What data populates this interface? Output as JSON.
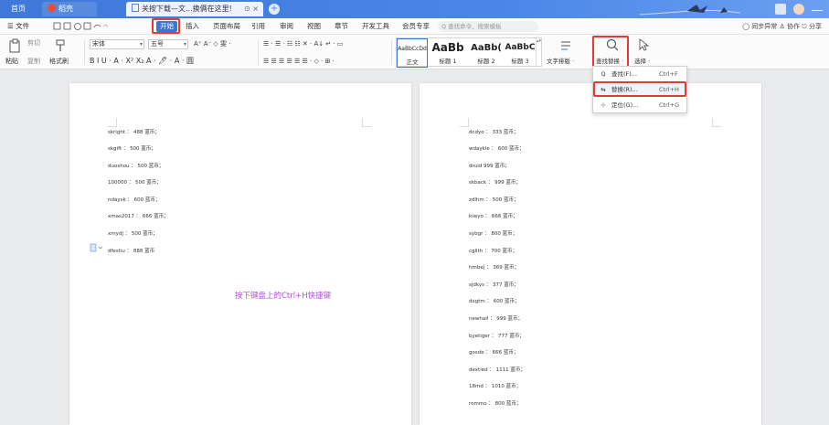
{
  "titlebar": {
    "home_tab": "首页",
    "dk_tab": "稻壳",
    "doc_tab": "关按下载—文...换俩在这里!",
    "doc_close": "⊙ ×",
    "new_tab": "+"
  },
  "menubar": {
    "file": "☰ 文件",
    "items": [
      "开始",
      "插入",
      "页面布局",
      "引用",
      "审阅",
      "视图",
      "章节",
      "开发工具",
      "会员专享"
    ],
    "search_placeholder": "Q 查找命令、搜索模板",
    "right": "◯ 同步异常  ♙ 协作  ⎋ 分享"
  },
  "ribbon": {
    "paste": "粘贴",
    "cut": "剪切",
    "copy": "复制",
    "format_painter": "格式刷",
    "font_name": "宋体",
    "font_size": "五号",
    "font_row2": "B  I  U · A · X² X₂  A · 🖊 · A · 圆",
    "font_row1": "A⁺ A⁻  ◇  雯 ·",
    "para_row1": "☰ · ☰ · ☷ ☷  ✕ · A↓ ↵ · ▭",
    "para_row2": "☰ ☰ ☰ ☰ ☰  ☰ · ◇ · ⊞ ·",
    "styles": [
      {
        "preview": "AaBbCcDd",
        "label": "正文"
      },
      {
        "preview": "AaBb",
        "label": "标题 1"
      },
      {
        "preview": "AaBb(",
        "label": "标题 2"
      },
      {
        "preview": "AaBbC",
        "label": "标题 3"
      }
    ],
    "text_layout": "文字排版 ·",
    "find_replace": "查找替换 ·",
    "select": "选择 ·"
  },
  "dropdown": {
    "items": [
      {
        "icon": "Q",
        "name": "查找(F)...",
        "shortcut": "Ctrl+F"
      },
      {
        "icon": "⇆",
        "name": "替换(R)...",
        "shortcut": "Ctrl+H"
      },
      {
        "icon": "⊹",
        "name": "定位(G)...",
        "shortcut": "Ctrl+G"
      }
    ]
  },
  "page1": {
    "lines": [
      "skright ： 488 蓝币；",
      "skgift ： 500 蓝币；",
      "duoshou ： 500 蓝币；",
      "100000 ： 500 蓝币；",
      "ndaysk ： 600 蓝币；",
      "xmas2017 ： 666 蓝币；",
      "xmydj ： 500 蓝币；",
      "dfestiu ： 888 蓝币"
    ],
    "hint": "按下键盘上的Ctrl+H快捷键"
  },
  "page2": {
    "lines": [
      "dcdyo ： 333 蓝币；",
      "wdaykle ： 600 蓝币；",
      "druid 999 蓝币；",
      "skback ： 999 蓝币；",
      "zdlhm ： 500 蓝币；",
      "kiwyo ： 666 蓝币；",
      "sybgr ： 800 蓝币；",
      "cglith ： 700 蓝币；",
      "hmbej ： 369 蓝币；",
      "sjdkys ： 377 蓝币；",
      "dxgtm ： 600 蓝币；",
      "newhall ： 999 蓝币；",
      "byetiger ： 777 蓝币；",
      "gosde ： 666 蓝币；",
      "dextied ： 1111 蓝币；",
      "18md ： 1010 蓝币；",
      "rommo ： 800 蓝币；"
    ]
  },
  "colors": {
    "accent": "#3d75d6",
    "highlight_box": "#e53935",
    "hint_text": "#b14fd6"
  }
}
